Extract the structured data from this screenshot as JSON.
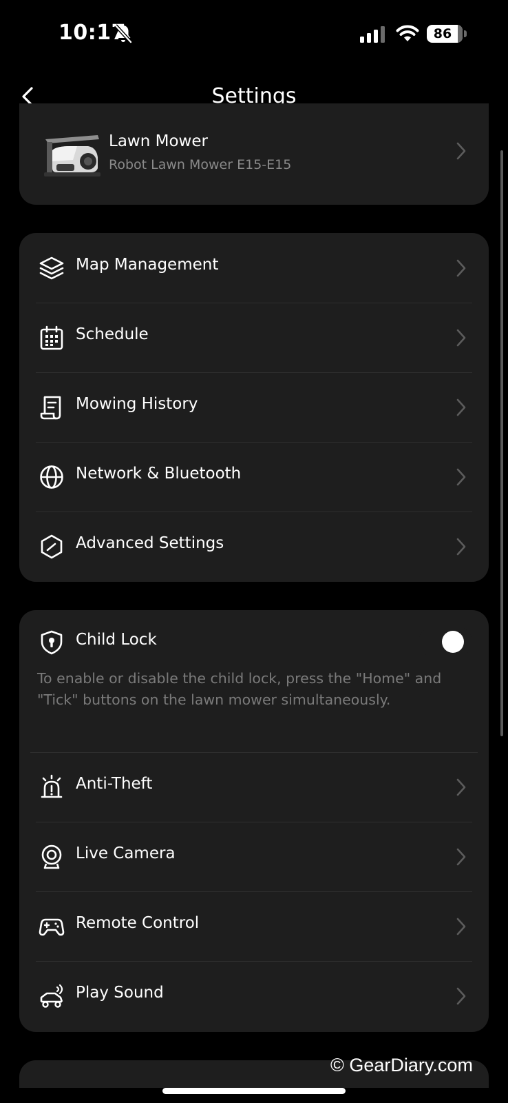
{
  "status": {
    "time": "10:17",
    "battery": "86",
    "battery_level": 0.86
  },
  "header": {
    "title": "Settings"
  },
  "device": {
    "name": "Lawn Mower",
    "model": "Robot Lawn Mower E15-E15"
  },
  "menu_primary": [
    {
      "label": "Map Management",
      "icon": "layers-icon"
    },
    {
      "label": "Schedule",
      "icon": "calendar-icon"
    },
    {
      "label": "Mowing History",
      "icon": "history-icon"
    },
    {
      "label": "Network & Bluetooth",
      "icon": "globe-icon"
    },
    {
      "label": "Advanced Settings",
      "icon": "hexagon-icon"
    }
  ],
  "child_lock": {
    "label": "Child Lock",
    "enabled": false,
    "hint": "To enable or disable the child lock, press the \"Home\" and \"Tick\" buttons on the lawn mower simultaneously."
  },
  "menu_secondary": [
    {
      "label": "Anti-Theft",
      "icon": "alarm-icon"
    },
    {
      "label": "Live Camera",
      "icon": "camera-icon"
    },
    {
      "label": "Remote Control",
      "icon": "gamepad-icon"
    },
    {
      "label": "Play Sound",
      "icon": "mower-sound-icon"
    }
  ],
  "watermark": "© GearDiary.com",
  "colors": {
    "background": "#000000",
    "card": "#1e1e1e",
    "divider": "#2f2f2f",
    "secondary_text": "#8a8a8a",
    "chevron": "#5c5c5c"
  }
}
